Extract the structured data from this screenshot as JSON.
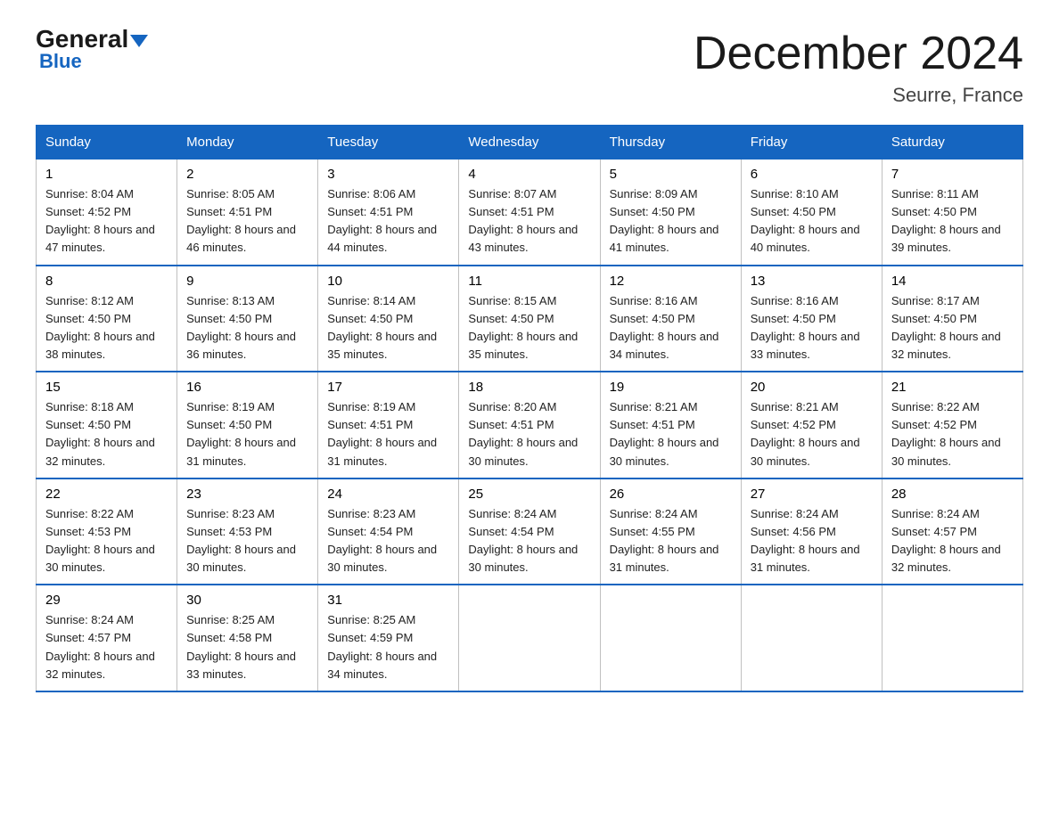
{
  "header": {
    "logo_general": "General",
    "logo_blue": "Blue",
    "main_title": "December 2024",
    "subtitle": "Seurre, France"
  },
  "weekdays": [
    "Sunday",
    "Monday",
    "Tuesday",
    "Wednesday",
    "Thursday",
    "Friday",
    "Saturday"
  ],
  "weeks": [
    [
      {
        "day": "1",
        "sunrise": "Sunrise: 8:04 AM",
        "sunset": "Sunset: 4:52 PM",
        "daylight": "Daylight: 8 hours and 47 minutes."
      },
      {
        "day": "2",
        "sunrise": "Sunrise: 8:05 AM",
        "sunset": "Sunset: 4:51 PM",
        "daylight": "Daylight: 8 hours and 46 minutes."
      },
      {
        "day": "3",
        "sunrise": "Sunrise: 8:06 AM",
        "sunset": "Sunset: 4:51 PM",
        "daylight": "Daylight: 8 hours and 44 minutes."
      },
      {
        "day": "4",
        "sunrise": "Sunrise: 8:07 AM",
        "sunset": "Sunset: 4:51 PM",
        "daylight": "Daylight: 8 hours and 43 minutes."
      },
      {
        "day": "5",
        "sunrise": "Sunrise: 8:09 AM",
        "sunset": "Sunset: 4:50 PM",
        "daylight": "Daylight: 8 hours and 41 minutes."
      },
      {
        "day": "6",
        "sunrise": "Sunrise: 8:10 AM",
        "sunset": "Sunset: 4:50 PM",
        "daylight": "Daylight: 8 hours and 40 minutes."
      },
      {
        "day": "7",
        "sunrise": "Sunrise: 8:11 AM",
        "sunset": "Sunset: 4:50 PM",
        "daylight": "Daylight: 8 hours and 39 minutes."
      }
    ],
    [
      {
        "day": "8",
        "sunrise": "Sunrise: 8:12 AM",
        "sunset": "Sunset: 4:50 PM",
        "daylight": "Daylight: 8 hours and 38 minutes."
      },
      {
        "day": "9",
        "sunrise": "Sunrise: 8:13 AM",
        "sunset": "Sunset: 4:50 PM",
        "daylight": "Daylight: 8 hours and 36 minutes."
      },
      {
        "day": "10",
        "sunrise": "Sunrise: 8:14 AM",
        "sunset": "Sunset: 4:50 PM",
        "daylight": "Daylight: 8 hours and 35 minutes."
      },
      {
        "day": "11",
        "sunrise": "Sunrise: 8:15 AM",
        "sunset": "Sunset: 4:50 PM",
        "daylight": "Daylight: 8 hours and 35 minutes."
      },
      {
        "day": "12",
        "sunrise": "Sunrise: 8:16 AM",
        "sunset": "Sunset: 4:50 PM",
        "daylight": "Daylight: 8 hours and 34 minutes."
      },
      {
        "day": "13",
        "sunrise": "Sunrise: 8:16 AM",
        "sunset": "Sunset: 4:50 PM",
        "daylight": "Daylight: 8 hours and 33 minutes."
      },
      {
        "day": "14",
        "sunrise": "Sunrise: 8:17 AM",
        "sunset": "Sunset: 4:50 PM",
        "daylight": "Daylight: 8 hours and 32 minutes."
      }
    ],
    [
      {
        "day": "15",
        "sunrise": "Sunrise: 8:18 AM",
        "sunset": "Sunset: 4:50 PM",
        "daylight": "Daylight: 8 hours and 32 minutes."
      },
      {
        "day": "16",
        "sunrise": "Sunrise: 8:19 AM",
        "sunset": "Sunset: 4:50 PM",
        "daylight": "Daylight: 8 hours and 31 minutes."
      },
      {
        "day": "17",
        "sunrise": "Sunrise: 8:19 AM",
        "sunset": "Sunset: 4:51 PM",
        "daylight": "Daylight: 8 hours and 31 minutes."
      },
      {
        "day": "18",
        "sunrise": "Sunrise: 8:20 AM",
        "sunset": "Sunset: 4:51 PM",
        "daylight": "Daylight: 8 hours and 30 minutes."
      },
      {
        "day": "19",
        "sunrise": "Sunrise: 8:21 AM",
        "sunset": "Sunset: 4:51 PM",
        "daylight": "Daylight: 8 hours and 30 minutes."
      },
      {
        "day": "20",
        "sunrise": "Sunrise: 8:21 AM",
        "sunset": "Sunset: 4:52 PM",
        "daylight": "Daylight: 8 hours and 30 minutes."
      },
      {
        "day": "21",
        "sunrise": "Sunrise: 8:22 AM",
        "sunset": "Sunset: 4:52 PM",
        "daylight": "Daylight: 8 hours and 30 minutes."
      }
    ],
    [
      {
        "day": "22",
        "sunrise": "Sunrise: 8:22 AM",
        "sunset": "Sunset: 4:53 PM",
        "daylight": "Daylight: 8 hours and 30 minutes."
      },
      {
        "day": "23",
        "sunrise": "Sunrise: 8:23 AM",
        "sunset": "Sunset: 4:53 PM",
        "daylight": "Daylight: 8 hours and 30 minutes."
      },
      {
        "day": "24",
        "sunrise": "Sunrise: 8:23 AM",
        "sunset": "Sunset: 4:54 PM",
        "daylight": "Daylight: 8 hours and 30 minutes."
      },
      {
        "day": "25",
        "sunrise": "Sunrise: 8:24 AM",
        "sunset": "Sunset: 4:54 PM",
        "daylight": "Daylight: 8 hours and 30 minutes."
      },
      {
        "day": "26",
        "sunrise": "Sunrise: 8:24 AM",
        "sunset": "Sunset: 4:55 PM",
        "daylight": "Daylight: 8 hours and 31 minutes."
      },
      {
        "day": "27",
        "sunrise": "Sunrise: 8:24 AM",
        "sunset": "Sunset: 4:56 PM",
        "daylight": "Daylight: 8 hours and 31 minutes."
      },
      {
        "day": "28",
        "sunrise": "Sunrise: 8:24 AM",
        "sunset": "Sunset: 4:57 PM",
        "daylight": "Daylight: 8 hours and 32 minutes."
      }
    ],
    [
      {
        "day": "29",
        "sunrise": "Sunrise: 8:24 AM",
        "sunset": "Sunset: 4:57 PM",
        "daylight": "Daylight: 8 hours and 32 minutes."
      },
      {
        "day": "30",
        "sunrise": "Sunrise: 8:25 AM",
        "sunset": "Sunset: 4:58 PM",
        "daylight": "Daylight: 8 hours and 33 minutes."
      },
      {
        "day": "31",
        "sunrise": "Sunrise: 8:25 AM",
        "sunset": "Sunset: 4:59 PM",
        "daylight": "Daylight: 8 hours and 34 minutes."
      },
      null,
      null,
      null,
      null
    ]
  ]
}
